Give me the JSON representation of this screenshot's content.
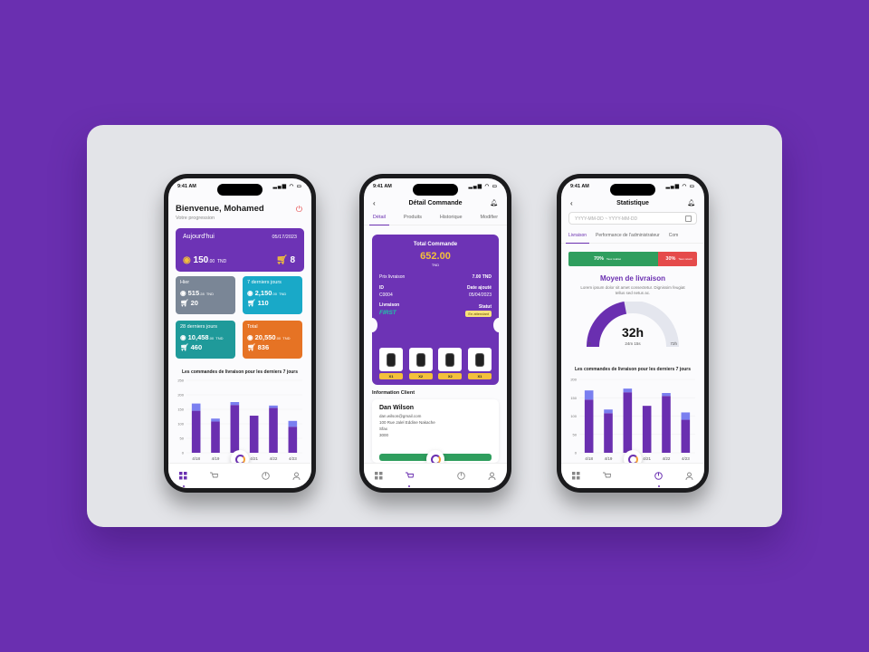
{
  "colors": {
    "background": "#6a2fb0",
    "primary": "#6d33b5",
    "bar_main": "#6a2fb0",
    "bar_top": "#7a7ff0",
    "gold": "#f3c03a",
    "green": "#2f9e5e",
    "red": "#e54b4b",
    "orange": "#e67324",
    "teal": "#1f9a9a",
    "cyan": "#19a9c8",
    "grey": "#7a8696"
  },
  "status_time": "9:41 AM",
  "phone1": {
    "title": "Bienvenue, Mohamed",
    "subtitle": "Votre progression",
    "today": {
      "label": "Aujourd'hui",
      "date": "05/17/2023",
      "amount": "150",
      "decimals": ".00",
      "currency": "TND",
      "orders": "8"
    },
    "tiles": [
      {
        "label": "Hier",
        "amount": "515",
        "decimals": ".28",
        "currency": "TND",
        "orders": "20",
        "color": "grey"
      },
      {
        "label": "7 derniers jours",
        "amount": "2,150",
        "decimals": ".00",
        "currency": "TND",
        "orders": "110",
        "color": "cyan"
      },
      {
        "label": "28 derniers jours",
        "amount": "10,458",
        "decimals": ".00",
        "currency": "TND",
        "orders": "460",
        "color": "teal"
      },
      {
        "label": "Total",
        "amount": "20,550",
        "decimals": ".00",
        "currency": "TND",
        "orders": "836",
        "color": "orange"
      }
    ],
    "chart_title": "Les commandes de livraison pour les derniers 7 jours"
  },
  "phone2": {
    "title": "Détail Commande",
    "tabs": [
      "Détail",
      "Produits",
      "Historique",
      "Modifier"
    ],
    "order": {
      "total_label": "Total Commande",
      "total_value": "652.00",
      "total_unit": "TND",
      "prix_livraison_label": "Prix livraison",
      "prix_livraison_value": "7.00 TND",
      "id_label": "ID",
      "id_value": "C0004",
      "date_label": "Date ajouté",
      "date_value": "05/04/2023",
      "livraison_label": "Livraison",
      "livraison_value": "FIRST",
      "statut_label": "Statut",
      "statut_value": "En attendant",
      "items": [
        "X1",
        "X2",
        "X2",
        "X1"
      ]
    },
    "client_section": "Information Client",
    "client": {
      "name": "Dan Wilson",
      "email": "dan.wilson@gmail.com",
      "address": "100 Rue Jalel Eddine Nakache",
      "city": "Sfax",
      "zip": "3000"
    }
  },
  "phone3": {
    "title": "Statistique",
    "date_placeholder": "YYYY-MM-DD ~ YYYY-MM-DD",
    "tabs": [
      "Livraison",
      "Performance de l'administrateur",
      "Com"
    ],
    "perf": {
      "good_pct": "70%",
      "good_label": "Taux réalisé",
      "bad_pct": "30%",
      "bad_label": "Taux retard",
      "good_value": 0.7
    },
    "moyen_title": "Moyen de livraison",
    "lorem": "Lorem ipsum dolor sit amet consectetur. Dignissim feugiat tellus sed netus ac.",
    "gauge": {
      "value": "32h",
      "sub": "24m 15s",
      "min": "0",
      "max": "72h",
      "fraction": 0.44
    },
    "chart_title": "Les commandes de livraison pour les derniers 7 jours"
  },
  "chart_data": [
    {
      "type": "bar",
      "chart": "phone1",
      "title": "Les commandes de livraison pour les derniers 7 jours",
      "categories": [
        "4/18",
        "4/19",
        "4/20",
        "4/21",
        "4/22",
        "4/23"
      ],
      "series": [
        {
          "values": [
            145,
            108,
            165,
            128,
            155,
            90
          ]
        },
        {
          "values": [
            25,
            10,
            10,
            0,
            8,
            20
          ]
        }
      ],
      "yticks": [
        0,
        50,
        100,
        150,
        200,
        250
      ],
      "ylim": [
        0,
        250
      ]
    },
    {
      "type": "bar",
      "chart": "phone3",
      "title": "Les commandes de livraison pour les derniers 7 jours",
      "categories": [
        "4/18",
        "4/19",
        "4/20",
        "4/21",
        "4/22",
        "4/23"
      ],
      "series": [
        {
          "values": [
            145,
            108,
            165,
            128,
            155,
            90
          ]
        },
        {
          "values": [
            25,
            10,
            10,
            0,
            8,
            20
          ]
        }
      ],
      "yticks": [
        0,
        50,
        100,
        150,
        200
      ],
      "ylim": [
        0,
        200
      ]
    }
  ],
  "nav_icons": [
    "grid-icon",
    "cart-icon",
    "pie-chart-icon",
    "user-icon"
  ]
}
